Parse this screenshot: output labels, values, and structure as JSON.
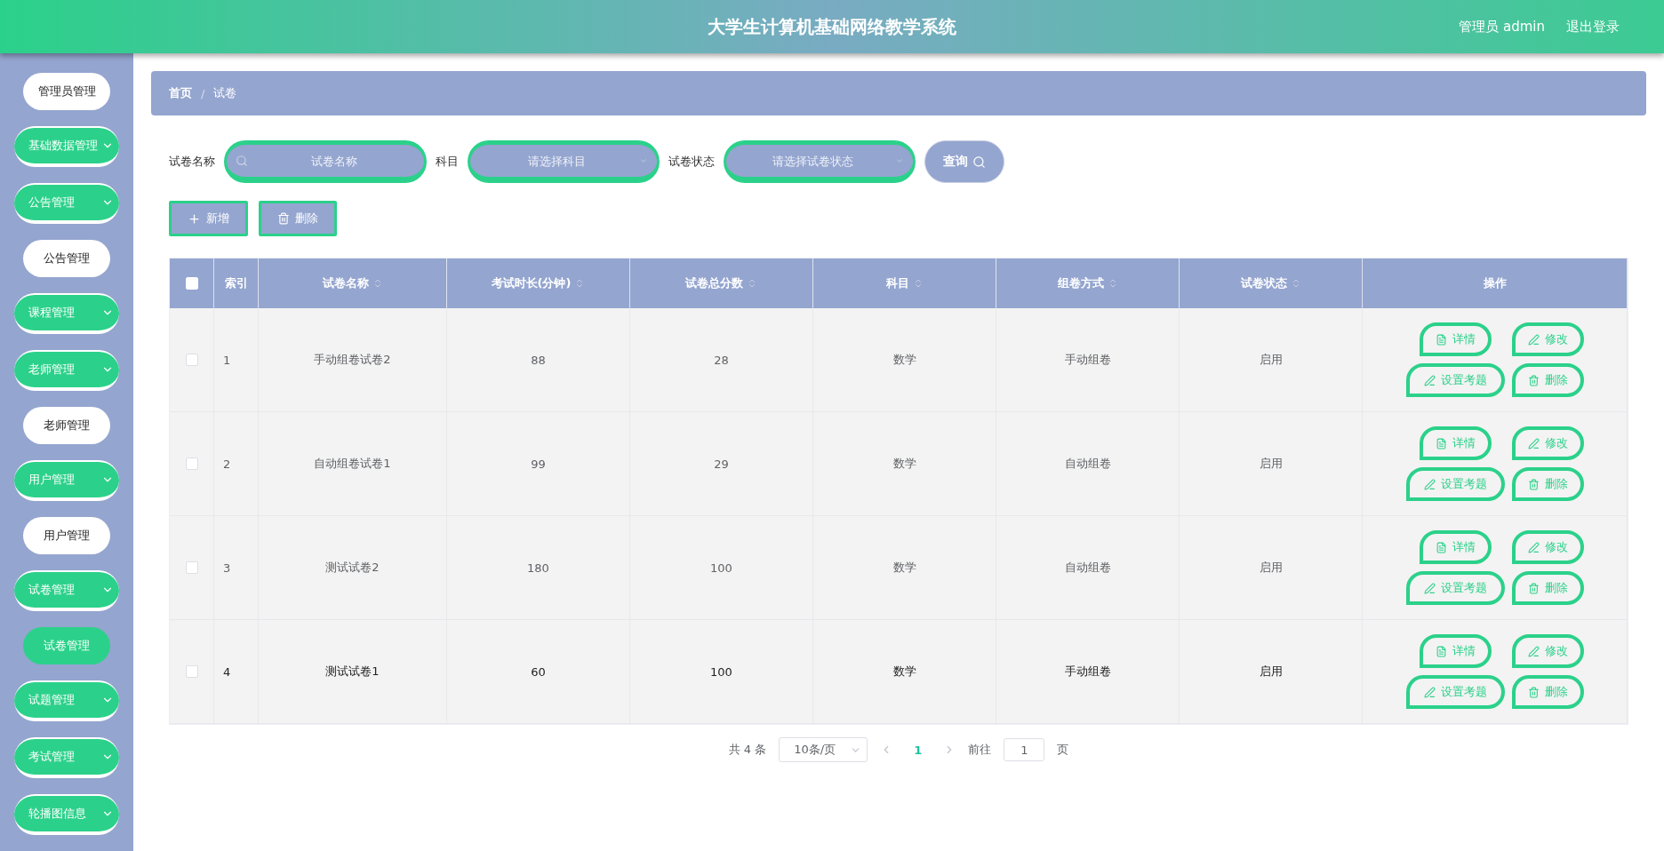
{
  "header": {
    "title": "大学生计算机基础网络教学系统",
    "user": "管理员 admin",
    "logout": "退出登录"
  },
  "sidebar": {
    "items": [
      {
        "kind": "link",
        "label": "管理员管理",
        "selected": false
      },
      {
        "kind": "group",
        "label": "基础数据管理"
      },
      {
        "kind": "group",
        "label": "公告管理",
        "children": [
          {
            "label": "公告管理",
            "selected": false
          }
        ]
      },
      {
        "kind": "group",
        "label": "课程管理"
      },
      {
        "kind": "group",
        "label": "老师管理",
        "children": [
          {
            "label": "老师管理",
            "selected": false
          }
        ]
      },
      {
        "kind": "group",
        "label": "用户管理",
        "children": [
          {
            "label": "用户管理",
            "selected": false
          }
        ]
      },
      {
        "kind": "group",
        "label": "试卷管理",
        "children": [
          {
            "label": "试卷管理",
            "selected": true
          }
        ]
      },
      {
        "kind": "group",
        "label": "试题管理"
      },
      {
        "kind": "group",
        "label": "考试管理"
      },
      {
        "kind": "group",
        "label": "轮播图信息"
      }
    ]
  },
  "breadcrumb": [
    "首页",
    "试卷"
  ],
  "breadcrumb_separator": "/",
  "filters": [
    {
      "kind": "text",
      "label": "试卷名称",
      "placeholder": "试卷名称"
    },
    {
      "kind": "select",
      "label": "科目",
      "placeholder": "请选择科目"
    },
    {
      "kind": "select",
      "label": "试卷状态",
      "placeholder": "请选择试卷状态"
    }
  ],
  "query_button": "查询",
  "toolbar": [
    {
      "kind": "add",
      "label": "新增"
    },
    {
      "kind": "delete",
      "label": "删除"
    }
  ],
  "table": {
    "all_checked": false,
    "columns": [
      {
        "label": "索引",
        "sortable": false
      },
      {
        "label": "试卷名称",
        "sortable": true
      },
      {
        "label": "考试时长(分钟)",
        "sortable": true
      },
      {
        "label": "试卷总分数",
        "sortable": true
      },
      {
        "label": "科目",
        "sortable": true
      },
      {
        "label": "组卷方式",
        "sortable": true
      },
      {
        "label": "试卷状态",
        "sortable": true
      },
      {
        "label": "操作",
        "sortable": false
      }
    ],
    "rows": [
      {
        "checked": false,
        "hovered": false,
        "cells": [
          "1",
          "手动组卷试卷2",
          "88",
          "28",
          "数学",
          "手动组卷",
          "启用"
        ],
        "actions": [
          {
            "kind": "detail",
            "label": "详情"
          },
          {
            "kind": "edit",
            "label": "修改"
          },
          {
            "kind": "edit",
            "label": "设置考题"
          },
          {
            "kind": "delete",
            "label": "删除"
          }
        ]
      },
      {
        "checked": false,
        "hovered": false,
        "cells": [
          "2",
          "自动组卷试卷1",
          "99",
          "29",
          "数学",
          "自动组卷",
          "启用"
        ],
        "actions": [
          {
            "kind": "detail",
            "label": "详情"
          },
          {
            "kind": "edit",
            "label": "修改"
          },
          {
            "kind": "edit",
            "label": "设置考题"
          },
          {
            "kind": "delete",
            "label": "删除"
          }
        ]
      },
      {
        "checked": false,
        "hovered": false,
        "cells": [
          "3",
          "测试试卷2",
          "180",
          "100",
          "数学",
          "自动组卷",
          "启用"
        ],
        "actions": [
          {
            "kind": "detail",
            "label": "详情"
          },
          {
            "kind": "edit",
            "label": "修改"
          },
          {
            "kind": "edit",
            "label": "设置考题"
          },
          {
            "kind": "delete",
            "label": "删除"
          }
        ]
      },
      {
        "checked": false,
        "hovered": true,
        "cells": [
          "4",
          "测试试卷1",
          "60",
          "100",
          "数学",
          "手动组卷",
          "启用"
        ],
        "actions": [
          {
            "kind": "detail",
            "label": "详情"
          },
          {
            "kind": "edit",
            "label": "修改"
          },
          {
            "kind": "edit",
            "label": "设置考题"
          },
          {
            "kind": "delete",
            "label": "删除"
          }
        ]
      }
    ]
  },
  "pagination": {
    "total": "共 4 条",
    "page_size": "10条/页",
    "pages": [
      {
        "label": "1",
        "selected": true
      }
    ],
    "goto_label": "前往",
    "goto_value": "1",
    "page_suffix": "页"
  }
}
